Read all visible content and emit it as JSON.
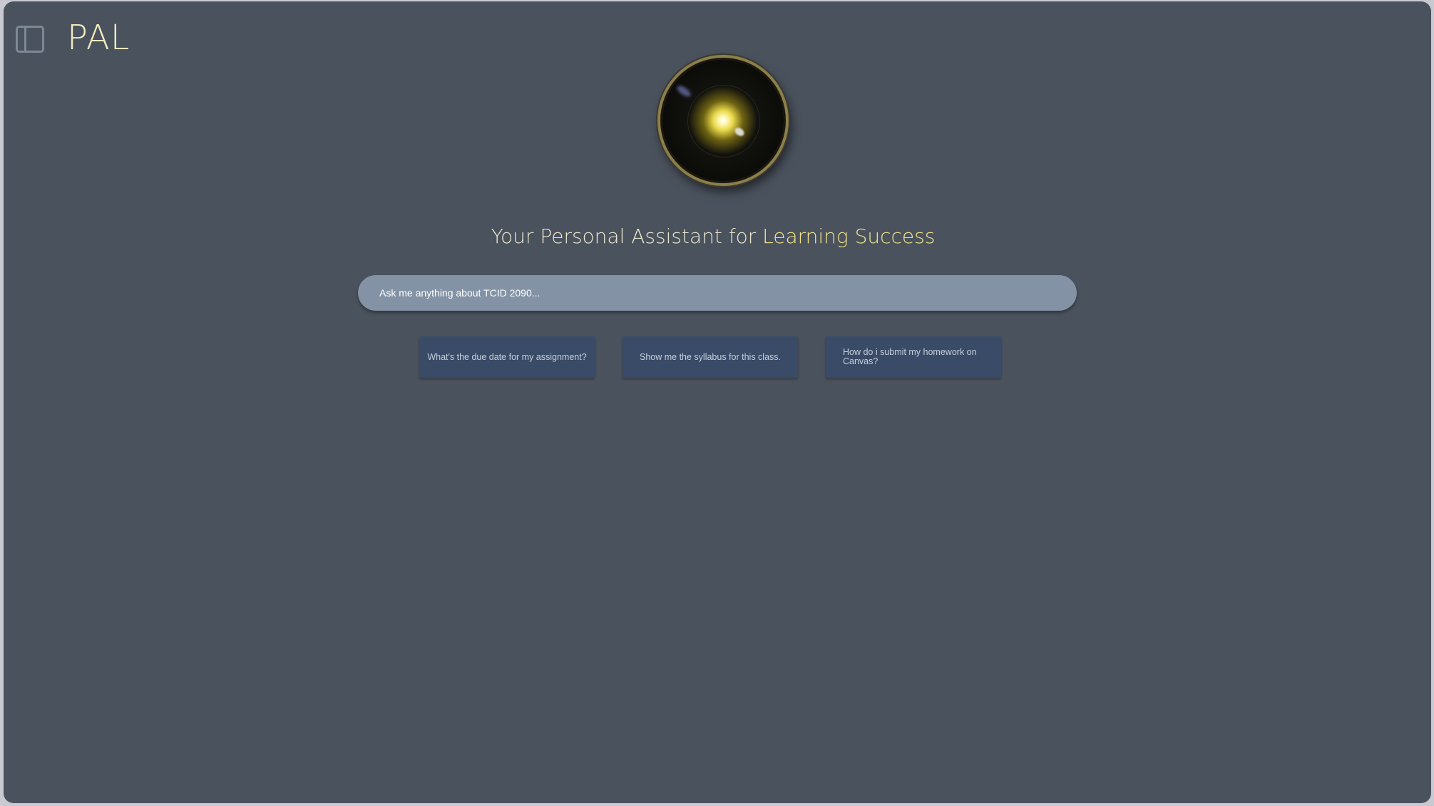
{
  "app": {
    "title": "PAL"
  },
  "hero": {
    "tagline_part1": "Your Personal ",
    "tagline_part2": "Assistant for ",
    "tagline_part3": "Learning Success",
    "orb_icon": "glowing-orb-icon"
  },
  "search": {
    "placeholder": "Ask me anything about TCID 2090..."
  },
  "suggestions": [
    {
      "label": "What's the due date for my assignment?"
    },
    {
      "label": "Show me the syllabus for this class."
    },
    {
      "label": "How do i submit my homework on Canvas?"
    }
  ],
  "colors": {
    "background": "#4a525d",
    "accent_yellow": "#f3e488",
    "title_cream": "#f2ecc0",
    "input_bg": "#8393a5",
    "suggestion_bg": "#3a4b68"
  }
}
